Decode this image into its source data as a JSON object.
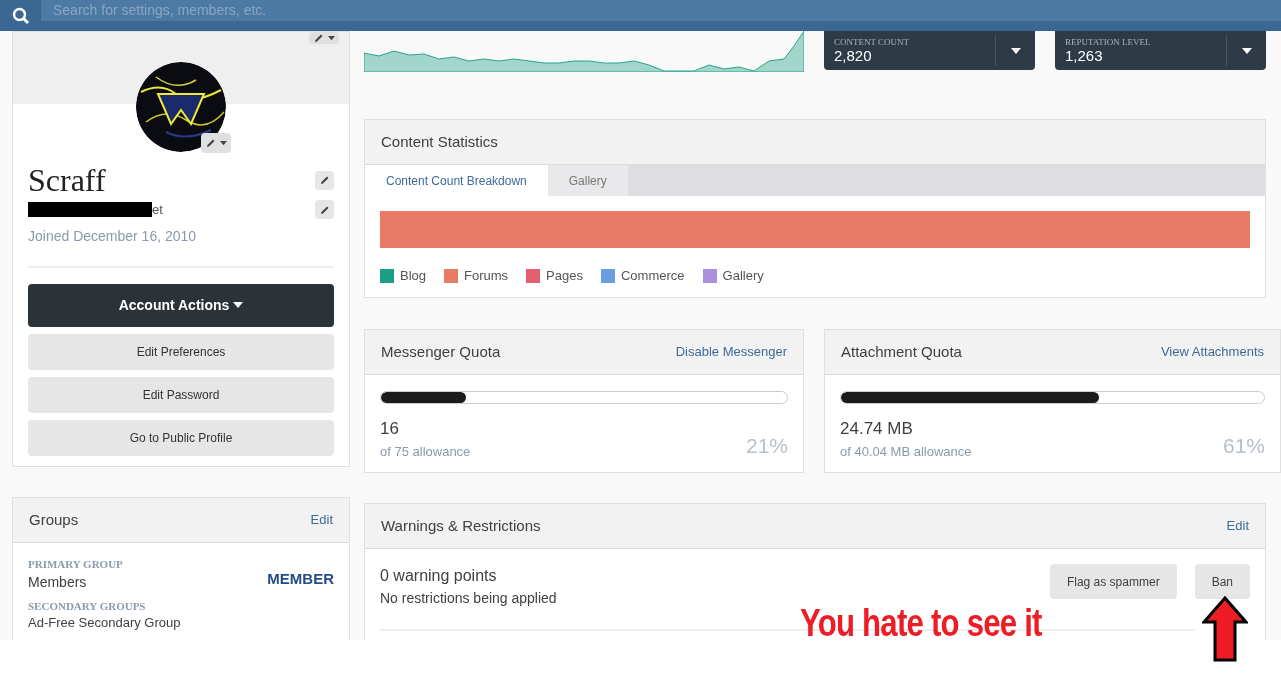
{
  "search": {
    "placeholder": "Search for settings, members, etc."
  },
  "profile": {
    "name": "Scraff",
    "email_tail": "et",
    "joined": "Joined December 16, 2010",
    "account_actions": "Account Actions",
    "buttons": [
      "Edit Preferences",
      "Edit Password",
      "Go to Public Profile"
    ]
  },
  "groups": {
    "title": "Groups",
    "edit": "Edit",
    "primary_label": "PRIMARY GROUP",
    "primary": "Members",
    "badge": "MEMBER",
    "secondary_label": "SECONDARY GROUPS",
    "secondary": "Ad-Free Secondary Group"
  },
  "stat_cards": [
    {
      "label": "CONTENT COUNT",
      "value": "2,820"
    },
    {
      "label": "REPUTATION LEVEL",
      "value": "1,263"
    }
  ],
  "content_statistics": {
    "title": "Content Statistics",
    "tabs": [
      {
        "label": "Content Count Breakdown",
        "selected": true
      },
      {
        "label": "Gallery",
        "selected": false
      }
    ],
    "legend": [
      {
        "label": "Blog",
        "color": "#1a9e84"
      },
      {
        "label": "Forums",
        "color": "#e97a66"
      },
      {
        "label": "Pages",
        "color": "#e25f6f"
      },
      {
        "label": "Commerce",
        "color": "#6b9ede"
      },
      {
        "label": "Gallery",
        "color": "#ab91dd"
      }
    ]
  },
  "quotas": [
    {
      "title": "Messenger Quota",
      "link": "Disable Messenger",
      "level": 0.21,
      "amount": "16",
      "allowance": "of 75 allowance",
      "percent": "21%"
    },
    {
      "title": "Attachment Quota",
      "link": "View Attachments",
      "level": 0.61,
      "amount": "24.74 MB",
      "allowance": "of 40.04 MB allowance",
      "percent": "61%"
    }
  ],
  "warnings": {
    "title": "Warnings & Restrictions",
    "edit": "Edit",
    "points": "0 warning points",
    "restrictions": "No restrictions being applied",
    "buttons": [
      "Flag as spammer",
      "Ban"
    ]
  },
  "overlay": {
    "caption": "You hate to see it"
  }
}
